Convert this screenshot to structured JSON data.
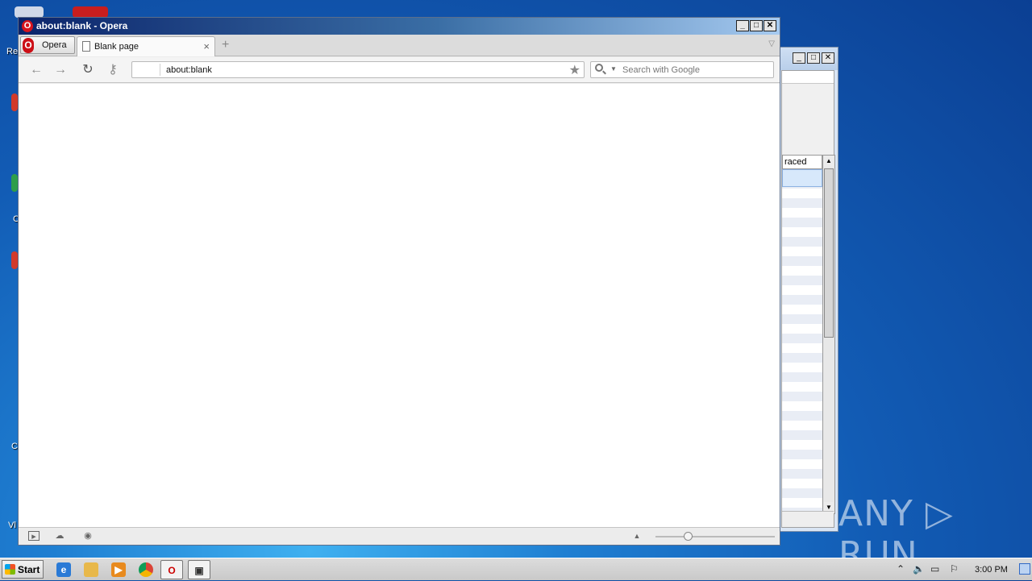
{
  "desktop": {
    "icon_labels": [
      "Re",
      "C",
      "C",
      "Vl"
    ]
  },
  "background_window": {
    "column_header": "raced",
    "minimize": "_",
    "maximize": "□",
    "close": "✕"
  },
  "opera": {
    "window_title": "about:blank - Opera",
    "menu_button": "Opera",
    "tab_label": "Blank page",
    "tab_close": "×",
    "new_tab": "+",
    "address_value": "about:blank",
    "search_placeholder": "Search with Google",
    "controls": {
      "minimize": "_",
      "maximize": "□",
      "close": "✕"
    }
  },
  "watermark": "ANY ▷ RUN",
  "taskbar": {
    "start_label": "Start",
    "clock": "3:00 PM"
  }
}
